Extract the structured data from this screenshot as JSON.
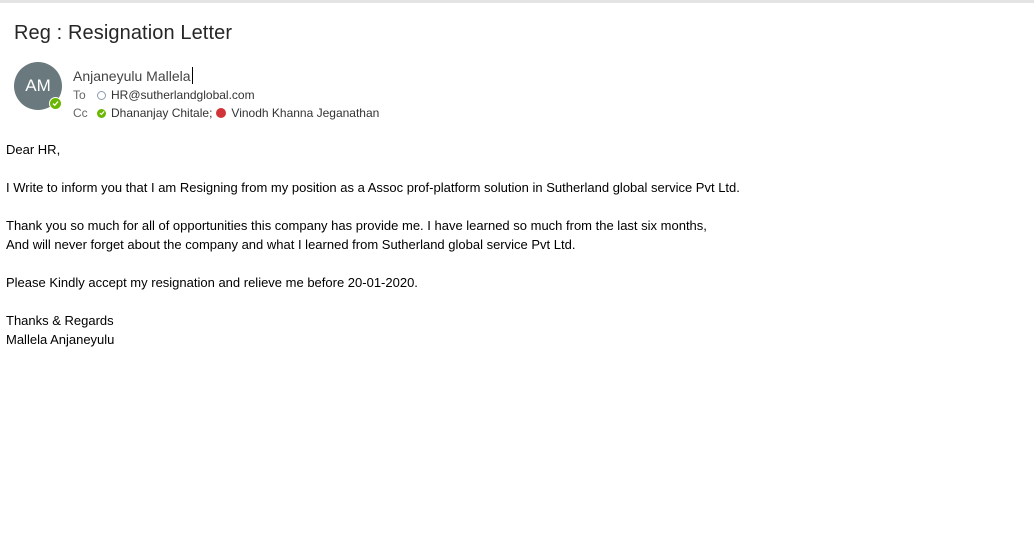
{
  "email": {
    "subject": "Reg : Resignation Letter",
    "avatar_initials": "AM",
    "sender": "Anjaneyulu Mallela",
    "to_label": "To",
    "to": "HR@sutherlandglobal.com",
    "cc_label": "Cc",
    "cc": [
      {
        "name": "Dhananjay Chitale;",
        "status": "available"
      },
      {
        "name": "Vinodh Khanna Jeganathan",
        "status": "busy"
      }
    ],
    "body": {
      "greeting": "Dear HR,",
      "para1": "I Write to inform you that I am Resigning from my position as a Assoc prof-platform solution in Sutherland global service Pvt Ltd.",
      "para2_line1": "Thank you so much for all of opportunities this company has provide me. I have learned so much from the last six months,",
      "para2_line2": "And will never forget about the company and what I learned from Sutherland global service Pvt Ltd.",
      "para3": "Please Kindly accept my resignation and relieve me before 20-01-2020.",
      "closing": "Thanks & Regards",
      "signature": "Mallela Anjaneyulu"
    }
  },
  "colors": {
    "avatar_bg": "#69797e",
    "available": "#6bb700",
    "busy": "#d13438"
  }
}
